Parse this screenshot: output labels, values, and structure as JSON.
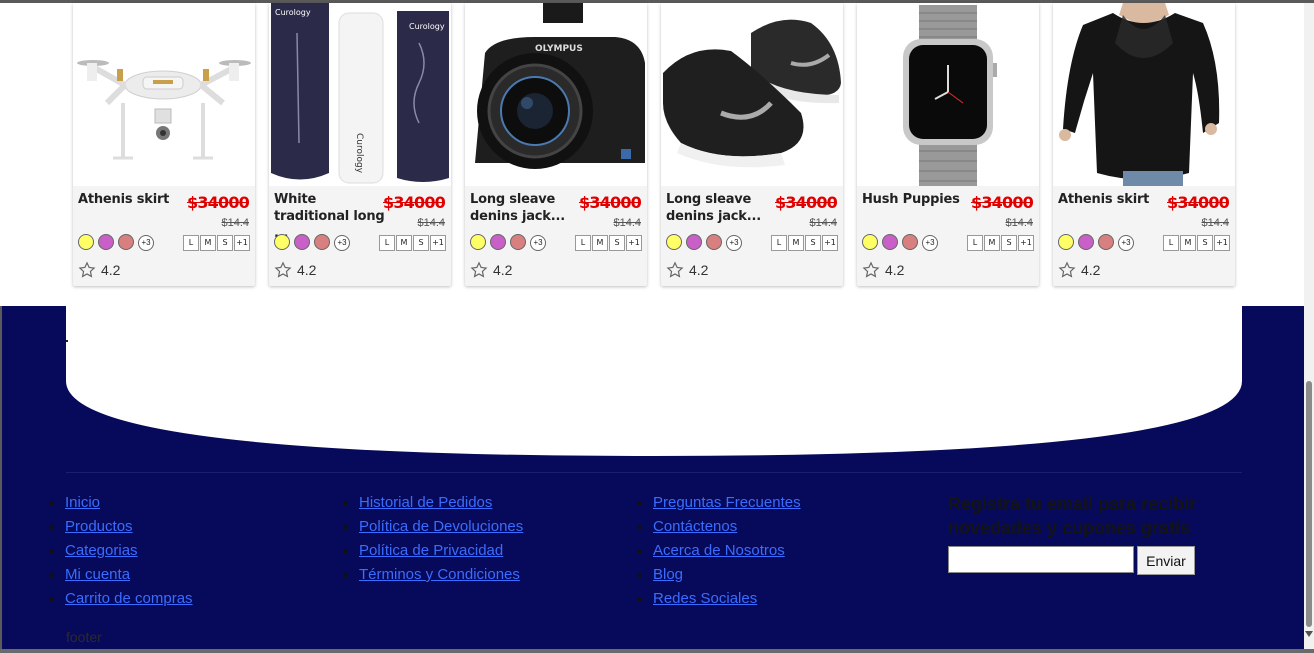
{
  "products": [
    {
      "name": "Athenis skirt",
      "price": "$34000",
      "old_price": "$14.4",
      "more_colors": "+3",
      "sizes": [
        "L",
        "M",
        "S",
        "+1"
      ],
      "rating": "4.2",
      "image": "drone"
    },
    {
      "name": "White traditional long ...",
      "price": "$34000",
      "old_price": "$14.4",
      "more_colors": "+3",
      "sizes": [
        "L",
        "M",
        "S",
        "+1"
      ],
      "rating": "4.2",
      "image": "skincare-tubes"
    },
    {
      "name": "Long sleave denins jack...",
      "price": "$34000",
      "old_price": "$14.4",
      "more_colors": "+3",
      "sizes": [
        "L",
        "M",
        "S",
        "+1"
      ],
      "rating": "4.2",
      "image": "camera"
    },
    {
      "name": "Long sleave denins jack...",
      "price": "$34000",
      "old_price": "$14.4",
      "more_colors": "+3",
      "sizes": [
        "L",
        "M",
        "S",
        "+1"
      ],
      "rating": "4.2",
      "image": "sneakers"
    },
    {
      "name": "Hush Puppies",
      "price": "$34000",
      "old_price": "$14.4",
      "more_colors": "+3",
      "sizes": [
        "L",
        "M",
        "S",
        "+1"
      ],
      "rating": "4.2",
      "image": "smartwatch"
    },
    {
      "name": "Athenis skirt",
      "price": "$34000",
      "old_price": "$14.4",
      "more_colors": "+3",
      "sizes": [
        "L",
        "M",
        "S",
        "+1"
      ],
      "rating": "4.2",
      "image": "black-blouse"
    }
  ],
  "swatch_colors": [
    "#ffff66",
    "#c860c8",
    "#d88080"
  ],
  "colors": {
    "footer_bg": "#070a5a",
    "link": "#3a6cff",
    "price": "#e00000"
  },
  "footer": {
    "col1": [
      "Inicio",
      "Productos",
      "Categorias",
      "Mi cuenta",
      "Carrito de compras"
    ],
    "col2": [
      "Historial de Pedidos",
      "Política de Devoluciones",
      "Política de Privacidad",
      "Términos y Condiciones"
    ],
    "col3": [
      "Preguntas Frecuentes",
      "Contáctenos",
      "Acerca de Nosotros",
      "Blog",
      "Redes Sociales"
    ],
    "newsletter_title": "Registra tu email para recibir novedades y cupones gratis",
    "newsletter_button": "Enviar",
    "label": "footer"
  }
}
